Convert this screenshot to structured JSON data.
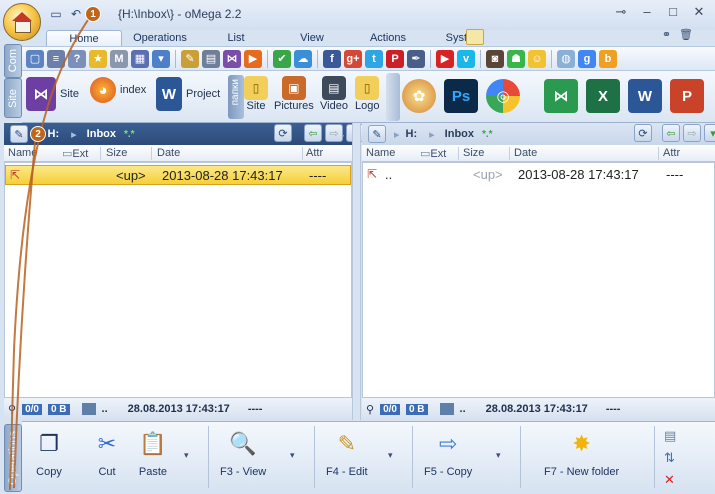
{
  "title": "{H:\\Inbox\\} - oMega 2.2",
  "tabs": [
    "Home",
    "Operations",
    "List",
    "View",
    "Actions",
    "System"
  ],
  "side_tabs": [
    "Com",
    "Site",
    "Operations"
  ],
  "launchers": {
    "vs": "Site",
    "firefox": "index",
    "word": "Project",
    "group": "папки",
    "folders": [
      "Site",
      "Pictures",
      "Video",
      "Logo"
    ]
  },
  "left_panel": {
    "drive": "H:",
    "folder": "Inbox",
    "mask": "*.*",
    "columns": {
      "name": "Name",
      "ext": "Ext",
      "size": "Size",
      "date": "Date",
      "attr": "Attr"
    },
    "rows": [
      {
        "name": "",
        "size": "<up>",
        "date": "2013-08-28 17:43:17",
        "attr": "----"
      }
    ],
    "status": {
      "count": "0/0",
      "size": "0 B",
      "dots": "..",
      "datetime": "28.08.2013 17:43:17",
      "attr": "----"
    }
  },
  "right_panel": {
    "drive": "H:",
    "folder": "Inbox",
    "mask": "*.*",
    "columns": {
      "name": "Name",
      "ext": "Ext",
      "size": "Size",
      "date": "Date",
      "attr": "Attr"
    },
    "rows": [
      {
        "name": "..",
        "size": "<up>",
        "date": "2013-08-28 17:43:17",
        "attr": "----"
      }
    ],
    "status": {
      "count": "0/0",
      "size": "0 B",
      "dots": "..",
      "datetime": "28.08.2013 17:43:17",
      "attr": "----"
    }
  },
  "operations": {
    "copy": "Copy",
    "cut": "Cut",
    "paste": "Paste",
    "view": "F3 - View",
    "edit": "F4 - Edit",
    "f5copy": "F5 - Copy",
    "newfolder": "F7 - New folder"
  },
  "badges": [
    "1",
    "2"
  ],
  "colors": {
    "accent": "#3b5f94",
    "selection": "#f5cf3a",
    "badge": "#c0661b"
  }
}
